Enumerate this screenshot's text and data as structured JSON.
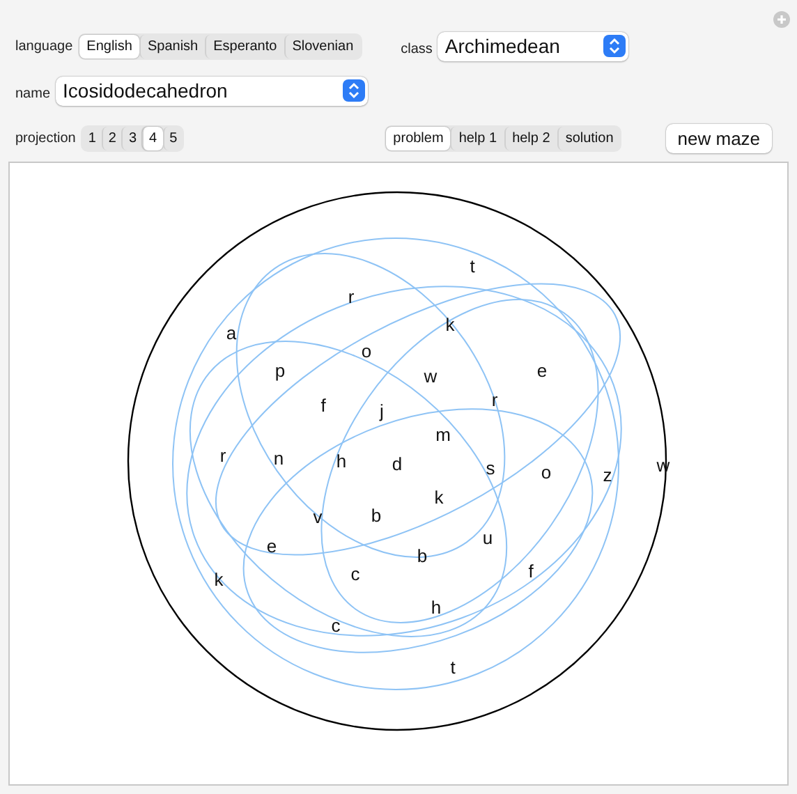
{
  "language": {
    "label": "language",
    "options": [
      {
        "label": "English",
        "selected": true
      },
      {
        "label": "Spanish",
        "selected": false
      },
      {
        "label": "Esperanto",
        "selected": false
      },
      {
        "label": "Slovenian",
        "selected": false
      }
    ]
  },
  "class": {
    "label": "class",
    "value": "Archimedean"
  },
  "name": {
    "label": "name",
    "value": "Icosidodecahedron"
  },
  "projection": {
    "label": "projection",
    "options": [
      {
        "label": "1",
        "selected": false
      },
      {
        "label": "2",
        "selected": false
      },
      {
        "label": "3",
        "selected": false
      },
      {
        "label": "4",
        "selected": true
      },
      {
        "label": "5",
        "selected": false
      }
    ]
  },
  "view": {
    "options": [
      {
        "label": "problem",
        "selected": true
      },
      {
        "label": "help 1",
        "selected": false
      },
      {
        "label": "help 2",
        "selected": false
      },
      {
        "label": "solution",
        "selected": false
      }
    ]
  },
  "new_maze_button": "new maze",
  "maze": {
    "letters": [
      "a",
      "r",
      "t",
      "k",
      "o",
      "p",
      "w",
      "e",
      "f",
      "j",
      "r",
      "m",
      "r",
      "n",
      "h",
      "d",
      "s",
      "o",
      "z",
      "w",
      "k",
      "v",
      "b",
      "e",
      "u",
      "b",
      "k",
      "c",
      "f",
      "h",
      "c",
      "t"
    ]
  }
}
